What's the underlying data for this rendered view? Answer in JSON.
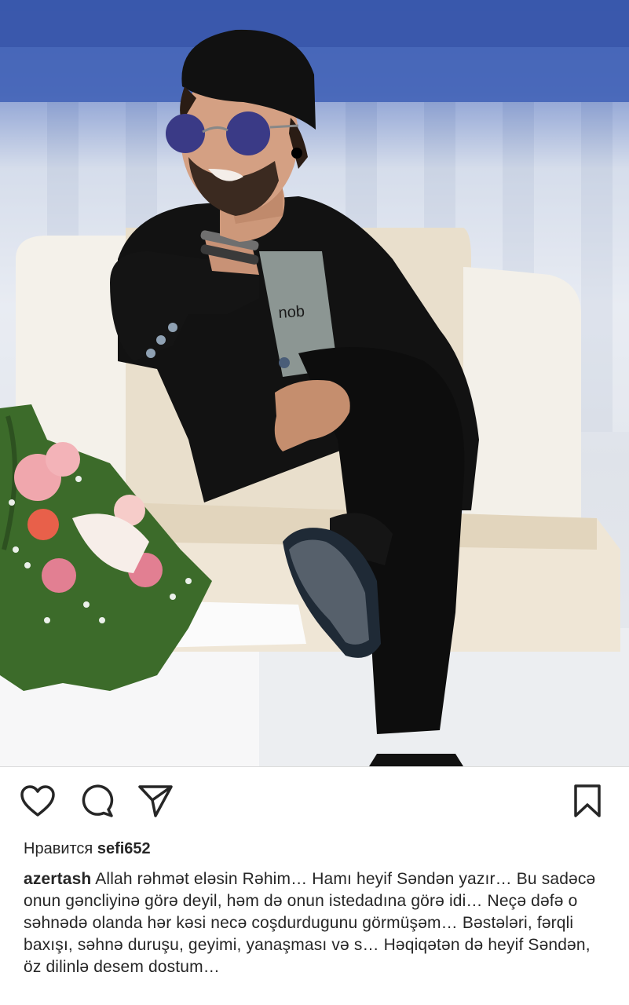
{
  "post": {
    "photo_alt": "post-photo",
    "actions": {
      "like_icon": "heart-icon",
      "comment_icon": "comment-icon",
      "share_icon": "send-icon",
      "save_icon": "bookmark-icon"
    },
    "likes": {
      "prefix": "Нравится",
      "user": "sefi652"
    },
    "caption": {
      "user": "azertash",
      "text": "Allah rəhmət eləsin Rəhim… Hamı heyif Səndən yazır… Bu sadəcə onun gəncliyinə görə deyil, həm də onun istedadına görə idi… Neçə dəfə o səhnədə olanda hər kəsi necə coşdurdugunu görmüşəm… Bəstələri, fərqli baxışı, səhnə duruşu, geyimi, yanaşması və s… Həqiqətən də heyif Səndən, öz dilinlə desem dostum…"
    }
  }
}
